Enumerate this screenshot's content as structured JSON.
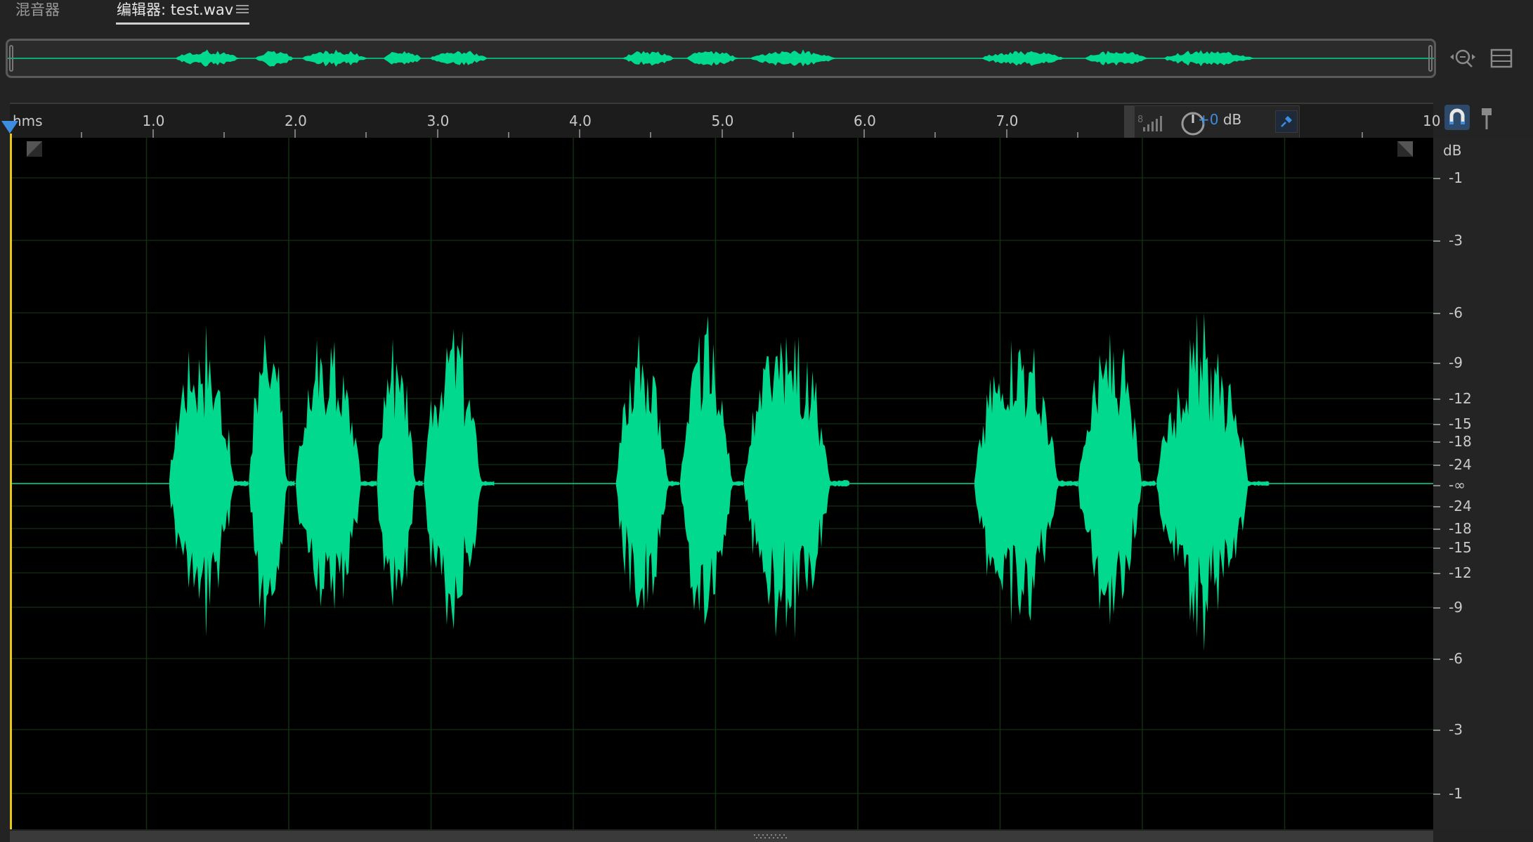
{
  "tabs": [
    {
      "label": "混音器",
      "active": false
    },
    {
      "label": "编辑器: test.wav",
      "active": true
    }
  ],
  "icons": {
    "tab_menu": "hamburger-menu-icon",
    "zoom": "zoom-navigator-icon",
    "layout": "panel-layout-icon",
    "signal": "signal-level-icon",
    "gain_knob": "gain-knob-icon",
    "pin": "pin-icon",
    "snap": "snap-magnet-icon",
    "marker": "marker-icon"
  },
  "ruler": {
    "unit_label": "hms",
    "labels": [
      "1.0",
      "2.0",
      "3.0",
      "4.0",
      "5.0",
      "6.0",
      "7.0",
      "10"
    ]
  },
  "hud": {
    "gain_value": "+0",
    "gain_unit": "dB",
    "meter_label": "8"
  },
  "db_axis": {
    "unit": "dB",
    "labels": [
      "-1",
      "-3",
      "-6",
      "-9",
      "-12",
      "-15",
      "-18",
      "-24",
      "-∞",
      "-24",
      "-18",
      "-15",
      "-12",
      "-9",
      "-6",
      "-3",
      "-1"
    ]
  },
  "colors": {
    "waveform": "#00d98e",
    "accent": "#3c8de0",
    "playhead": "#e6c619",
    "background": "#000000"
  },
  "waveform": {
    "duration_seconds": 10,
    "view_end_seconds": 10,
    "bursts_seconds": [
      [
        1.16,
        1.72
      ],
      [
        1.72,
        2.05
      ],
      [
        2.05,
        2.62
      ],
      [
        2.62,
        2.95
      ],
      [
        2.95,
        3.45
      ],
      [
        4.3,
        4.75
      ],
      [
        4.75,
        5.2
      ],
      [
        5.2,
        5.95
      ],
      [
        6.82,
        7.55
      ],
      [
        7.55,
        8.1
      ],
      [
        8.1,
        8.9
      ]
    ]
  }
}
